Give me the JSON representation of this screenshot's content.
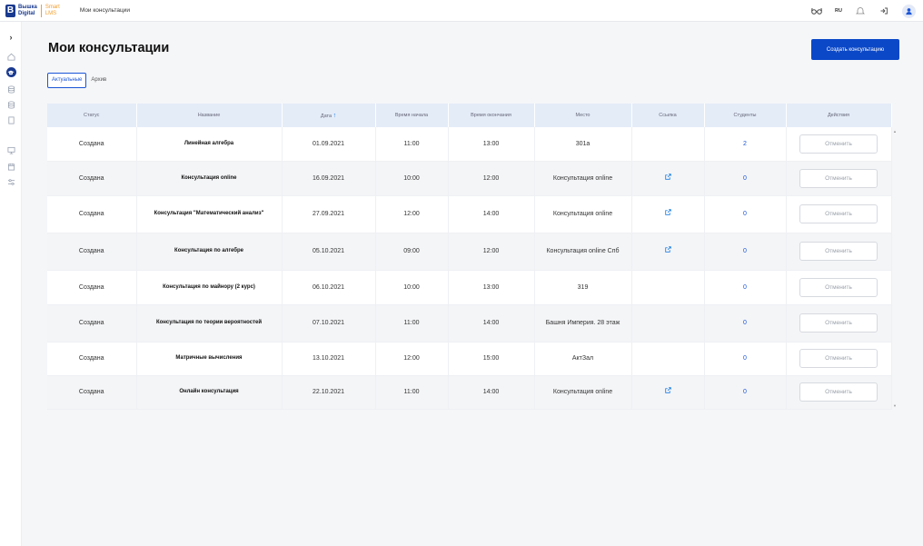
{
  "header": {
    "logo_line1": "Вышка",
    "logo_line2": "Digital",
    "logo_smart1": "Smart",
    "logo_smart2": "LMS",
    "title": "Мои консультации",
    "lang": "RU"
  },
  "sidebar": {
    "icons": [
      "chevron-right-icon",
      "home-icon",
      "graduation-cap-icon",
      "database-icon",
      "database-icon",
      "book-icon",
      "monitor-icon",
      "calendar-icon",
      "sliders-icon"
    ]
  },
  "page": {
    "title": "Мои консультации",
    "create_label": "Создать консультацию",
    "tabs": [
      "Актуальные",
      "Архив"
    ]
  },
  "table": {
    "headers": [
      "Статус",
      "Название",
      "Дата",
      "Время начала",
      "Время окончания",
      "Место",
      "Ссылка",
      "Студенты",
      "Действия"
    ],
    "sort_arrow": "↑",
    "cancel_label": "Отменить",
    "rows": [
      {
        "status": "Создана",
        "name": "Линейная алгебра",
        "date": "01.09.2021",
        "start": "11:00",
        "end": "13:00",
        "place": "301а",
        "link": false,
        "students": "2"
      },
      {
        "status": "Создана",
        "name": "Консультация online",
        "date": "16.09.2021",
        "start": "10:00",
        "end": "12:00",
        "place": "Консультация online",
        "link": true,
        "students": "0"
      },
      {
        "status": "Создана",
        "name": "Консультация \"Математический анализ\"",
        "date": "27.09.2021",
        "start": "12:00",
        "end": "14:00",
        "place": "Консультация online",
        "link": true,
        "students": "0"
      },
      {
        "status": "Создана",
        "name": "Консультация по алгебре",
        "date": "05.10.2021",
        "start": "09:00",
        "end": "12:00",
        "place": "Консультация online Спб",
        "link": true,
        "students": "0"
      },
      {
        "status": "Создана",
        "name": "Консультация по майнору (2 курс)",
        "date": "06.10.2021",
        "start": "10:00",
        "end": "13:00",
        "place": "319",
        "link": false,
        "students": "0"
      },
      {
        "status": "Создана",
        "name": "Консультация по теории вероятностей",
        "date": "07.10.2021",
        "start": "11:00",
        "end": "14:00",
        "place": "Башня Империя. 28 этаж",
        "link": false,
        "students": "0"
      },
      {
        "status": "Создана",
        "name": "Матричные вычисления",
        "date": "13.10.2021",
        "start": "12:00",
        "end": "15:00",
        "place": "АктЗал",
        "link": false,
        "students": "0"
      },
      {
        "status": "Создана",
        "name": "Онлайн консультация",
        "date": "22.10.2021",
        "start": "11:00",
        "end": "14:00",
        "place": "Консультация online",
        "link": true,
        "students": "0"
      }
    ]
  },
  "colors": {
    "accent": "#0b48c8",
    "brand": "#1a3a8f",
    "brand_orange": "#f29f2f",
    "header_row": "#e4ecf8",
    "link": "#1a55d6"
  }
}
